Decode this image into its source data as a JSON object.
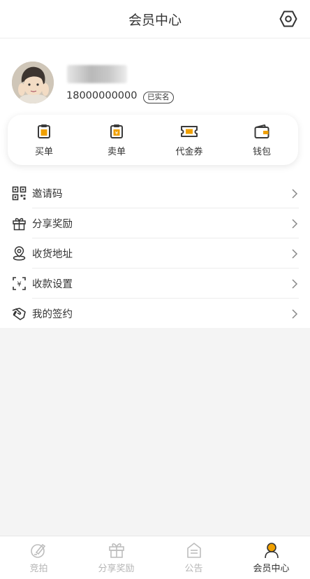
{
  "header": {
    "title": "会员中心",
    "settings_icon": "settings-hex-icon"
  },
  "profile": {
    "phone": "18000000000",
    "verified_badge": "已实名"
  },
  "quick_actions": [
    {
      "label": "买单",
      "icon": "clipboard-icon"
    },
    {
      "label": "卖单",
      "icon": "clipboard-icon"
    },
    {
      "label": "代金券",
      "icon": "ticket-icon"
    },
    {
      "label": "钱包",
      "icon": "wallet-icon"
    }
  ],
  "menu": [
    {
      "label": "邀请码",
      "icon": "qrcode-icon"
    },
    {
      "label": "分享奖励",
      "icon": "gift-icon"
    },
    {
      "label": "收货地址",
      "icon": "location-icon"
    },
    {
      "label": "收款设置",
      "icon": "scan-payment-icon"
    },
    {
      "label": "我的签约",
      "icon": "handshake-icon"
    }
  ],
  "bottom_nav": [
    {
      "label": "竞拍",
      "icon": "auction-icon",
      "active": false
    },
    {
      "label": "分享奖励",
      "icon": "gift-icon",
      "active": false
    },
    {
      "label": "公告",
      "icon": "notice-icon",
      "active": false
    },
    {
      "label": "会员中心",
      "icon": "user-icon",
      "active": true
    }
  ],
  "colors": {
    "accent": "#f0a000",
    "inactive": "#b6b6b6",
    "text": "#333333",
    "background": "#f4f4f4"
  }
}
